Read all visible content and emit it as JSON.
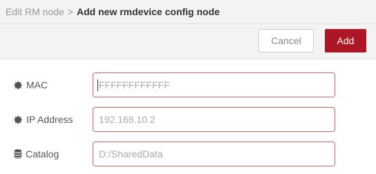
{
  "header": {
    "breadcrumb": "Edit RM node",
    "separator": ">",
    "title": "Add new rmdevice config node"
  },
  "toolbar": {
    "cancel_label": "Cancel",
    "add_label": "Add",
    "accent_color": "#ad1625"
  },
  "form": {
    "fields": [
      {
        "label": "MAC",
        "icon": "gear-icon",
        "value": "",
        "placeholder": "FFFFFFFFFFFF"
      },
      {
        "label": "IP Address",
        "icon": "gear-icon",
        "value": "",
        "placeholder": "192.168.10.2"
      },
      {
        "label": "Catalog",
        "icon": "database-icon",
        "value": "",
        "placeholder": "D:/SharedData"
      }
    ],
    "invalid_border_color": "#d6615f"
  }
}
